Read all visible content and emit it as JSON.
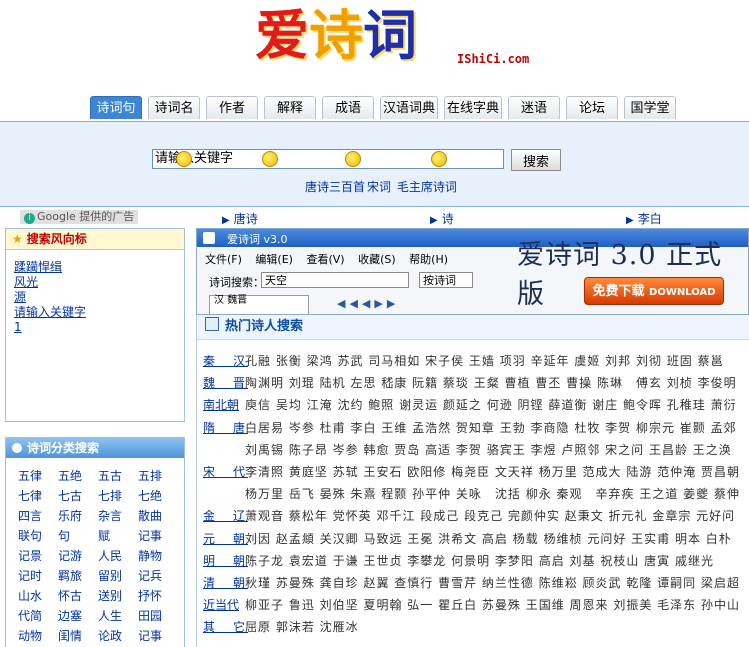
{
  "logo": {
    "chars": [
      "爱",
      "诗",
      "词"
    ],
    "domain": "IShiCi.com"
  },
  "tabs": [
    "诗词句",
    "诗词名",
    "作者",
    "解释",
    "成语",
    "汉语词典",
    "在线字典",
    "迷语",
    "论坛",
    "国学堂"
  ],
  "active_tab": 0,
  "search": {
    "value": "请输入关键字",
    "button": "搜索",
    "links": [
      "唐诗三百首",
      "宋词",
      "毛主席诗词"
    ]
  },
  "ads": {
    "google": "Google 提供的广告",
    "links": [
      "唐诗",
      "诗",
      "李白"
    ]
  },
  "trend": {
    "title": "搜索风向标",
    "items": [
      "蹂躏悍缉",
      "风光",
      "源",
      "请输入关键字",
      "1"
    ]
  },
  "categories": {
    "title": "诗词分类搜索",
    "items": [
      "五律",
      "五绝",
      "五古",
      "五排",
      "七律",
      "七古",
      "七排",
      "七绝",
      "四言",
      "乐府",
      "杂言",
      "散曲",
      "联句",
      "句",
      "赋",
      "记事",
      "记景",
      "记游",
      "人民",
      "静物",
      "记时",
      "羁旅",
      "留别",
      "记兵",
      "山水",
      "怀古",
      "送别",
      "抒怀",
      "代简",
      "边塞",
      "人生",
      "田园",
      "动物",
      "闺情",
      "论政",
      "记事"
    ]
  },
  "banner": {
    "window_title": "爱诗词 v3.0",
    "menu": [
      "文件(F)",
      "编辑(E)",
      "查看(V)",
      "收藏(S)",
      "帮助(H)"
    ],
    "search_label": "诗词搜索：",
    "search_value": "天空",
    "mode": "按诗词",
    "tree_items": [
      "汉",
      "魏晋"
    ],
    "headline": "爱诗词 3.0 正式版",
    "download": "免费下载",
    "download_en": "DOWNLOAD"
  },
  "poets": {
    "title": "热门诗人搜索",
    "rows": [
      {
        "dynasty": "秦　汉",
        "names": "孔融 张衡 梁鸿 苏武 司马相如 宋子侯 王嫱 项羽 辛延年 虞姬 刘邦 刘彻 班固 蔡邕"
      },
      {
        "dynasty": "魏　晋",
        "names": "陶渊明 刘琨 陆机 左思 嵇康 阮籍 蔡琰 王粲 曹植 曹丕 曹操 陈琳　傅玄 刘桢 李俊明"
      },
      {
        "dynasty": "南北朝",
        "names": "庾信 吴均 江淹 沈约 鲍照 谢灵运 颜延之 何逊 阴铿 薛道衡 谢庄 鲍令晖 孔稚珪 萧衍"
      },
      {
        "dynasty": "隋　唐",
        "names": "白居易 岑参 杜甫 李白 王维 孟浩然 贺知章 王勃 李商隐 杜牧 李贺 柳宗元 崔颢 孟郊"
      },
      {
        "dynasty": "",
        "names": "刘禹锡 陈子昂 岑参 韩愈 贾岛 高适 李贺 骆宾王 李煜 卢照邻 宋之问 王昌龄 王之涣"
      },
      {
        "dynasty": "宋　代",
        "names": "李清照 黄庭坚 苏轼 王安石 欧阳修 梅尧臣 文天祥 杨万里 范成大 陆游 范仲淹 贾昌朝"
      },
      {
        "dynasty": "",
        "names": "杨万里 岳飞 晏殊 朱熹 程颢 孙平仲 关咏　沈括 柳永 秦观　辛弃疾 王之道 姜夔 蔡伸"
      },
      {
        "dynasty": "金　辽",
        "names": "萧观音 蔡松年 党怀英 邓千江 段成己 段克己 完颜仲实 赵秉文 折元礼 金章宗 元好问"
      },
      {
        "dynasty": "元　朝",
        "names": "刘因 赵孟頫 关汉卿 马致远 王冕 洪希文 高启 杨载 杨维桢 元问好 王实甫 明本 白朴"
      },
      {
        "dynasty": "明　朝",
        "names": "陈子龙 袁宏道 于谦 王世贞 李攀龙 何景明 李梦阳 高启 刘基 祝枝山 唐寅 戚继光"
      },
      {
        "dynasty": "清　朝",
        "names": "秋瑾 苏曼殊 龚自珍 赵翼 查慎行 曹雪芹 纳兰性德 陈维崧 顾炎武 乾隆 谭嗣同 梁启超"
      },
      {
        "dynasty": "近当代",
        "names": "柳亚子 鲁迅 刘伯坚 夏明翰 弘一 瞿丘白 苏曼殊 王国维 周恩来 刘振美 毛泽东 孙中山"
      },
      {
        "dynasty": "其　它",
        "names": "屈原 郭沫若 沈雁冰"
      }
    ]
  }
}
